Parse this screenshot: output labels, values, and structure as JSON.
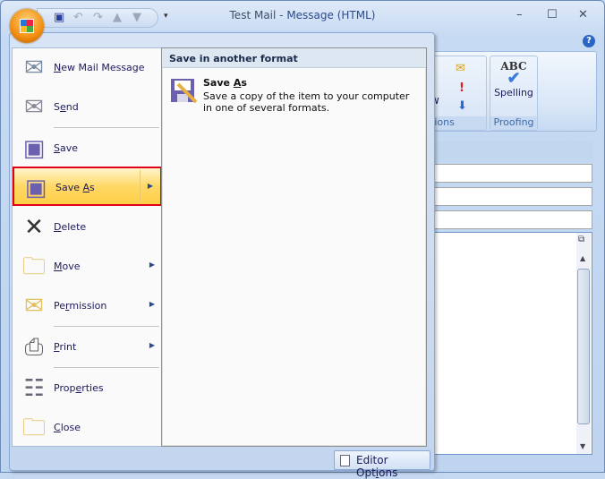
{
  "window": {
    "title_doc": "Test Mail",
    "title_sep": " - ",
    "title_type": "Message (HTML)",
    "minimize": "–",
    "maximize": "☐",
    "close": "✕",
    "help": "?"
  },
  "qat": [
    "save-icon",
    "undo-icon",
    "redo-icon",
    "previous-icon",
    "next-icon"
  ],
  "ribbon": {
    "options_group": "tions",
    "options_partial_button": "w",
    "proofing_group": "Proofing",
    "spelling": "Spelling",
    "spelling_icon_text": "ABC"
  },
  "menu": {
    "items": [
      {
        "id": "new-mail-message",
        "pre": "",
        "key": "N",
        "post": "ew Mail Message",
        "icon": "new-mail-icon"
      },
      {
        "id": "send",
        "pre": "S",
        "key": "e",
        "post": "nd",
        "icon": "send-icon"
      },
      {
        "id": "save",
        "pre": "",
        "key": "S",
        "post": "ave",
        "icon": "save-icon"
      },
      {
        "id": "save-as",
        "pre": "Save ",
        "key": "A",
        "post": "s",
        "icon": "save-as-icon",
        "submenu": true,
        "selected": true
      },
      {
        "id": "delete",
        "pre": "",
        "key": "D",
        "post": "elete",
        "icon": "delete-icon"
      },
      {
        "id": "move",
        "pre": "",
        "key": "M",
        "post": "ove",
        "icon": "move-icon",
        "submenu": true
      },
      {
        "id": "permission",
        "pre": "Pe",
        "key": "r",
        "post": "mission",
        "icon": "permission-icon",
        "submenu": true
      },
      {
        "id": "print",
        "pre": "",
        "key": "P",
        "post": "rint",
        "icon": "print-icon",
        "submenu": true
      },
      {
        "id": "properties",
        "pre": "Prop",
        "key": "e",
        "post": "rties",
        "icon": "properties-icon"
      },
      {
        "id": "close",
        "pre": "",
        "key": "C",
        "post": "lose",
        "icon": "close-folder-icon"
      }
    ],
    "submenu": {
      "heading": "Save in another format",
      "option": {
        "pre": "Save ",
        "key": "A",
        "post": "s",
        "description": "Save a copy of the item to your computer in one of several formats."
      }
    },
    "editor_options": {
      "pre": "Editor Opt",
      "key": "i",
      "post": "ons"
    }
  },
  "colors": {
    "selected_outline": "#e0001a",
    "highlight": "#ffd865",
    "text": "#1a1a5c"
  }
}
